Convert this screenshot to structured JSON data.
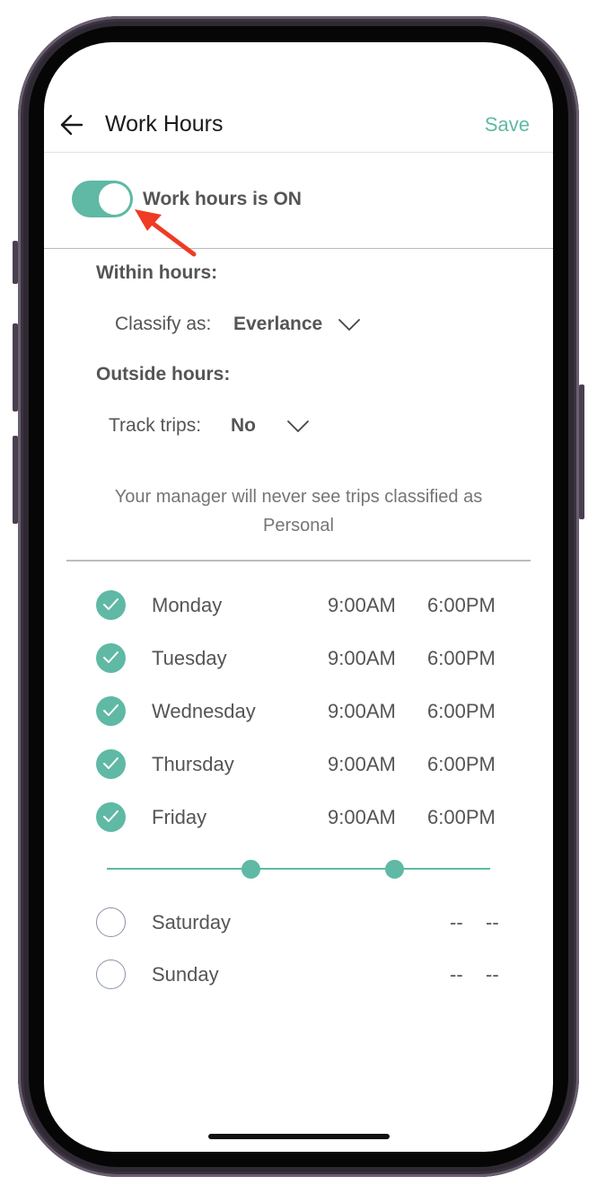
{
  "header": {
    "title": "Work Hours",
    "save_label": "Save",
    "back_icon": "arrow-left-icon"
  },
  "work_hours_toggle": {
    "label": "Work hours is ON",
    "on": true,
    "color": "#5fb9a4"
  },
  "within_hours": {
    "title": "Within hours:",
    "classify_label": "Classify as:",
    "classify_value": "Everlance"
  },
  "outside_hours": {
    "title": "Outside hours:",
    "track_label": "Track trips:",
    "track_value": "No"
  },
  "note": "Your manager will never see trips classified as Personal",
  "days": [
    {
      "name": "Monday",
      "checked": true,
      "start": "9:00AM",
      "end": "6:00PM"
    },
    {
      "name": "Tuesday",
      "checked": true,
      "start": "9:00AM",
      "end": "6:00PM"
    },
    {
      "name": "Wednesday",
      "checked": true,
      "start": "9:00AM",
      "end": "6:00PM"
    },
    {
      "name": "Thursday",
      "checked": true,
      "start": "9:00AM",
      "end": "6:00PM"
    },
    {
      "name": "Friday",
      "checked": true,
      "start": "9:00AM",
      "end": "6:00PM"
    }
  ],
  "time_slider": {
    "start_fraction": 0.375,
    "end_fraction": 0.75
  },
  "weekend_days": [
    {
      "name": "Saturday",
      "checked": false,
      "start": "--",
      "end": "--"
    },
    {
      "name": "Sunday",
      "checked": false,
      "start": "--",
      "end": "--"
    }
  ],
  "colors": {
    "accent": "#5fb9a4",
    "annotation_arrow": "#ef3b24"
  }
}
